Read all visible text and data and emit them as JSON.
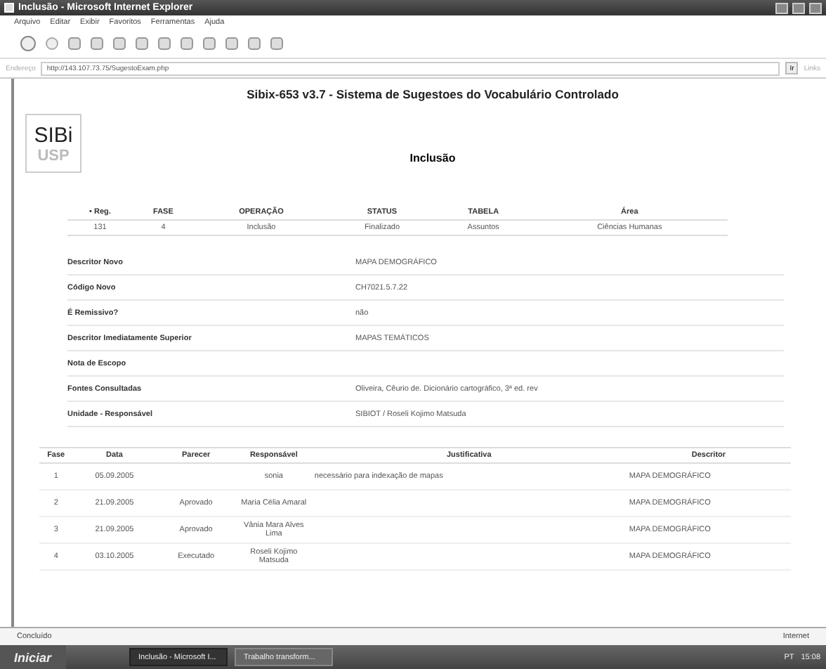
{
  "window": {
    "title": "Inclusão - Microsoft Internet Explorer"
  },
  "menu": [
    "Arquivo",
    "Editar",
    "Exibir",
    "Favoritos",
    "Ferramentas",
    "Ajuda"
  ],
  "address": {
    "label": "Endereço",
    "value": "http://143.107.73.75/SugestoExam.php",
    "go": "Ir",
    "links": "Links"
  },
  "page": {
    "heading": "Sibix-653 v3.7 - Sistema de Sugestoes do Vocabulário Controlado",
    "logo_top": "SIBi",
    "logo_bottom": "USP",
    "title": "Inclusão",
    "summary": {
      "columns": [
        "• Reg.",
        "FASE",
        "OPERAÇÃO",
        "STATUS",
        "TABELA",
        "Área"
      ],
      "row": [
        "131",
        "4",
        "Inclusão",
        "Finalizado",
        "Assuntos",
        "Ciências Humanas"
      ]
    },
    "details": [
      {
        "label": "Descritor Novo",
        "value": "MAPA DEMOGRÁFICO"
      },
      {
        "label": "Código Novo",
        "value": "CH7021.5.7.22"
      },
      {
        "label": "É Remissivo?",
        "value": "não"
      },
      {
        "label": "Descritor Imediatamente Superior",
        "value": "MAPAS TEMÁTICOS"
      },
      {
        "label": "Nota de Escopo"
      },
      {
        "label": "Fontes Consultadas",
        "value": "Oliveira, Cêurio de. Dicionário cartográfico, 3ª ed. rev"
      },
      {
        "label": "Unidade - Responsável",
        "value": "SIBIOT / Roseli Kojimo Matsuda"
      }
    ],
    "history": {
      "columns": [
        "Fase",
        "Data",
        "Parecer",
        "Responsável",
        "Justificativa",
        "Descritor"
      ],
      "rows": [
        [
          "1",
          "05.09.2005",
          "",
          "sonia",
          "necessário para indexação de mapas",
          "MAPA DEMOGRÁFICO"
        ],
        [
          "2",
          "21.09.2005",
          "Aprovado",
          "Maria Célia Amaral",
          "",
          "MAPA DEMOGRÁFICO"
        ],
        [
          "3",
          "21.09.2005",
          "Aprovado",
          "Vânia Mara Alves Lima",
          "",
          "MAPA DEMOGRÁFICO"
        ],
        [
          "4",
          "03.10.2005",
          "Executado",
          "Roseli Kojimo Matsuda",
          "",
          "MAPA DEMOGRÁFICO"
        ]
      ]
    }
  },
  "status_bar": {
    "text": "Concluído",
    "zone": "Internet"
  },
  "taskbar": {
    "start": "Iniciar",
    "tasks": [
      {
        "label": "Inclusão - Microsoft I...",
        "selected": true
      },
      {
        "label": "Trabalho transform...",
        "selected": false
      }
    ],
    "lang": "PT",
    "clock": "15:08"
  }
}
